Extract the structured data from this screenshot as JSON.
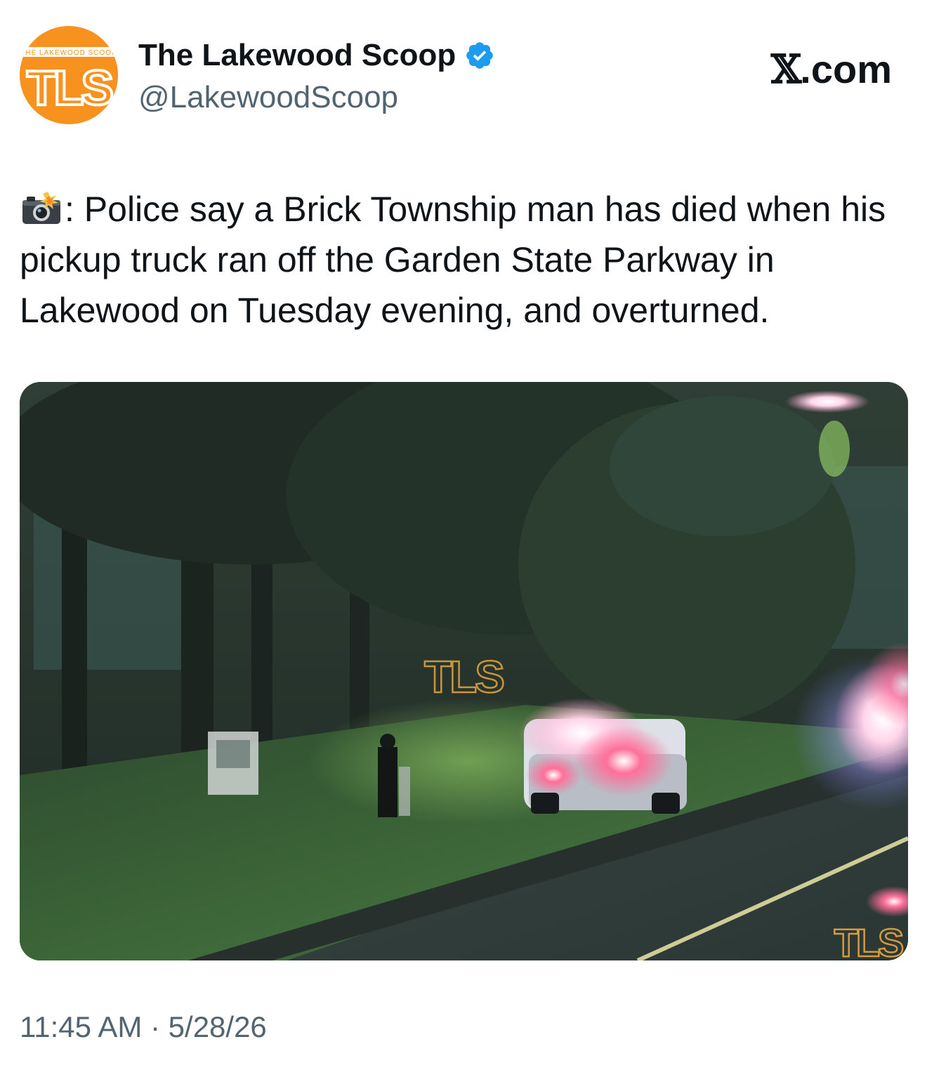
{
  "author": {
    "display_name": "The Lakewood Scoop",
    "handle": "@LakewoodScoop",
    "verified": true,
    "avatar": {
      "logo_text": "TLS",
      "logo_ring_text": "THE LAKEWOOD SCOOP",
      "bg_color": "#f7921e"
    }
  },
  "brand": {
    "x_letter": "𝕏",
    "suffix": ".com"
  },
  "tweet": {
    "icon": "camera-flash-icon",
    "text": ": Police say a Brick Township man has died when his pickup truck ran off the Garden State Parkway in Lakewood on Tuesday evening, and overturned.",
    "media": {
      "description_icon": "photo",
      "watermark_text": "TLS",
      "corner_watermark_text": "TLS"
    }
  },
  "footer": {
    "timestamp": "11:45 AM · 5/28/26"
  },
  "colors": {
    "text_primary": "#0f1419",
    "text_secondary": "#536471",
    "verified_blue": "#1d9bf0",
    "brand_orange": "#f7921e"
  }
}
